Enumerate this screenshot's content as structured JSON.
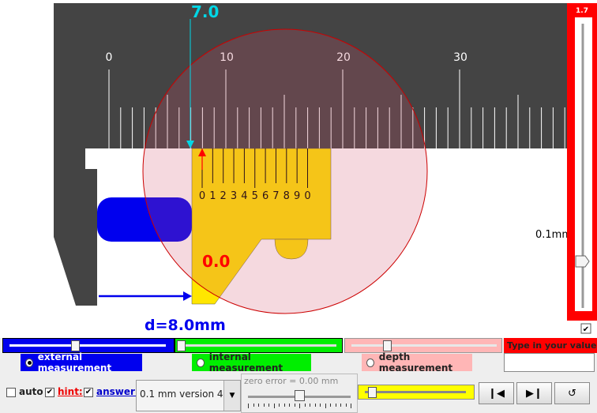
{
  "ruler": {
    "labels": [
      "0",
      "10",
      "20",
      "30"
    ],
    "vernier_digits": [
      "0",
      "1",
      "2",
      "3",
      "4",
      "5",
      "6",
      "7",
      "8",
      "9",
      "0"
    ]
  },
  "readings": {
    "main_reading": "7.0",
    "vernier_reading": "0.0",
    "diameter": "d=8.0mm"
  },
  "side_panel": {
    "top_value": "1.7",
    "unit_label": "0.1mm",
    "slider_fraction": 0.19
  },
  "modes": {
    "external": "external measurement",
    "internal": "internal measurement",
    "depth": "depth measurement",
    "selected": "external"
  },
  "input": {
    "placeholder": "Type in your value !",
    "value": ""
  },
  "options": {
    "auto_label": "auto",
    "auto_checked": false,
    "hint_label": "hint:",
    "hint_checked": true,
    "answer_label": "answer:",
    "answer_checked": true,
    "version_selected": "0.1 mm version 4",
    "zero_error": "zero error = 0.00 mm"
  },
  "controls": {
    "prev_icon": "step-back-icon",
    "next_icon": "step-forward-icon",
    "reset_icon": "reset-icon"
  },
  "colors": {
    "jaw": "#ffe600",
    "object": "#0000ee",
    "highlight": "#ff0000",
    "hint": "#00d7e6"
  }
}
